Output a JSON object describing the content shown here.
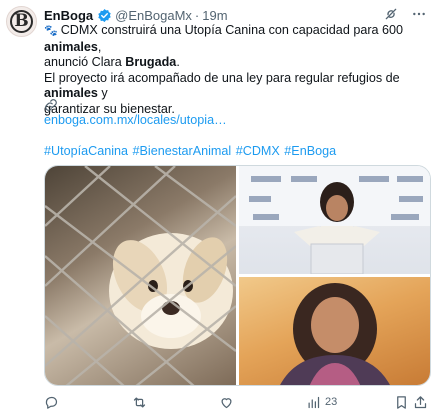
{
  "tweet": {
    "avatar_letter": "B",
    "display_name": "EnBoga",
    "handle": "@EnBogaMx",
    "separator": "·",
    "time": "19m",
    "text_line1_part1": "CDMX construirá una Utopía Canina con capacidad para 600 ",
    "text_line1_bold": "animales",
    "text_line1_part2": ",",
    "text_line2_part1": "anunció Clara ",
    "text_line2_bold": "Brugada",
    "text_line2_part2": ".",
    "text_line3_part1": "El proyecto irá acompañado de una ley para regular refugios de ",
    "text_line3_bold": "animales",
    "text_line3_part2": " y",
    "text_line4": "garantizar su bienestar.",
    "link": "enboga.com.mx/locales/utopia…",
    "hashtags": "#UtopíaCanina #BienestarAnimal #CDMX #EnBoga",
    "views_count": "23"
  },
  "icons": {
    "paw": "paw-prints-icon",
    "verified": "verified-badge-icon",
    "grok": "grok-icon",
    "more": "more-icon",
    "link": "link-icon",
    "reply": "reply-icon",
    "retweet": "retweet-icon",
    "like": "heart-icon",
    "views": "views-icon",
    "bookmark": "bookmark-icon",
    "share": "share-icon"
  },
  "colors": {
    "accent": "#1d9bf0",
    "secondary_text": "#536471",
    "text": "#0f1419"
  }
}
